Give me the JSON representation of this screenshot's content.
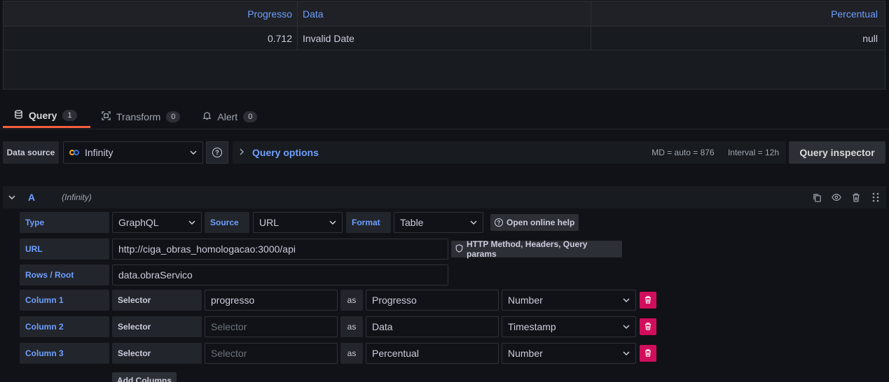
{
  "result_table": {
    "headers": [
      "Progresso",
      "Data",
      "Percentual"
    ],
    "rows": [
      [
        "0.712",
        "Invalid Date",
        "null"
      ]
    ]
  },
  "tabs": [
    {
      "label": "Query",
      "count": "1",
      "icon": "database-icon"
    },
    {
      "label": "Transform",
      "count": "0",
      "icon": "transform-icon"
    },
    {
      "label": "Alert",
      "count": "0",
      "icon": "bell-icon"
    }
  ],
  "datasource": {
    "label": "Data source",
    "selected": "Infinity",
    "query_options": "Query options",
    "md": "MD = auto = 876",
    "interval": "Interval = 12h",
    "inspector": "Query inspector"
  },
  "query_row": {
    "letter": "A",
    "datasource_name": "(Infinity)"
  },
  "form": {
    "type_label": "Type",
    "type_value": "GraphQL",
    "source_label": "Source",
    "source_value": "URL",
    "format_label": "Format",
    "format_value": "Table",
    "help_label": "Open online help",
    "url_label": "URL",
    "url_value": "http://ciga_obras_homologacao:3000/api",
    "http_label": "HTTP Method, Headers, Query params",
    "root_label": "Rows / Root",
    "root_value": "data.obraServico",
    "selector_label": "Selector",
    "as_label": "as",
    "selector_placeholder": "Selector",
    "add_columns": "Add Columns",
    "columns": [
      {
        "label": "Column 1",
        "selector": "progresso",
        "alias": "Progresso",
        "type": "Number"
      },
      {
        "label": "Column 2",
        "selector": "",
        "alias": "Data",
        "type": "Timestamp"
      },
      {
        "label": "Column 3",
        "selector": "",
        "alias": "Percentual",
        "type": "Number"
      }
    ]
  }
}
